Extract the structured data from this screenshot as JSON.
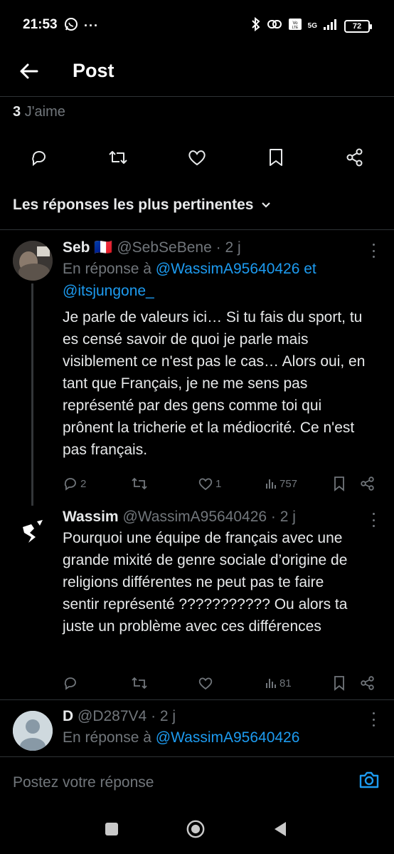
{
  "status_bar": {
    "time": "21:53",
    "dots": "···",
    "network": "5G",
    "battery": "72"
  },
  "header": {
    "title": "Post"
  },
  "stats": {
    "likes_count": "3",
    "likes_label": "J'aime"
  },
  "sort": {
    "label": "Les réponses les plus pertinentes"
  },
  "replies": [
    {
      "name": "Seb",
      "flag": "🇫🇷",
      "handle": "@SebSeBene",
      "time": "· 2 j",
      "reply_prefix": "En réponse à",
      "reply_handles": [
        "@WassimA95640426 et",
        "@itsjungone_"
      ],
      "text": "Je parle de valeurs ici… Si tu fais du sport, tu es censé savoir de quoi je parle mais visiblement ce n'est pas le cas… Alors oui, en tant que Français, je ne me sens pas représenté par des gens comme toi qui prônent la tricherie et la médiocrité. Ce n'est pas français.",
      "replies_count": "2",
      "likes_count": "1",
      "views_count": "757"
    },
    {
      "name": "Wassim",
      "handle": "@WassimA95640426",
      "time": "· 2 j",
      "text": "Pourquoi une équipe de français avec une grande mixité de genre sociale d’origine de religions différentes ne peut pas te faire sentir représenté ??????????? Ou alors ta juste un problème avec ces différences",
      "views_count": "81"
    },
    {
      "name": "D",
      "handle": "@D287V4",
      "time": "· 2 j",
      "reply_prefix": "En réponse à",
      "reply_handles": [
        "@WassimA95640426"
      ]
    }
  ],
  "compose": {
    "placeholder": "Postez votre réponse"
  },
  "colors": {
    "background": "#000000",
    "accent": "#1d9bf0",
    "muted": "#71767b",
    "text": "#e7e9ea"
  },
  "icons": {
    "header": [
      "back-arrow-icon"
    ],
    "actions": [
      "reply-icon",
      "repost-icon",
      "like-icon",
      "bookmark-icon",
      "share-icon"
    ],
    "compose": [
      "camera-icon"
    ],
    "nav": [
      "recent-apps-icon",
      "home-icon",
      "back-triangle-icon"
    ]
  }
}
